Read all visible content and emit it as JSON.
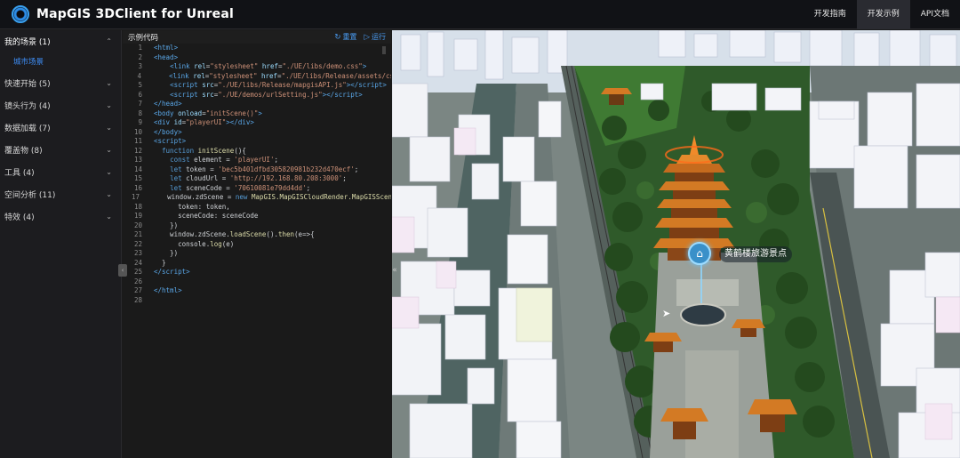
{
  "app": {
    "title": "MapGIS 3DClient for Unreal"
  },
  "nav": {
    "items": [
      {
        "label": "开发指南",
        "active": false
      },
      {
        "label": "开发示例",
        "active": true
      },
      {
        "label": "API文档",
        "active": false
      }
    ]
  },
  "sidebar": {
    "groups": [
      {
        "label": "我的场景 (1)",
        "open": true
      },
      {
        "label": "快速开始 (5)"
      },
      {
        "label": "镜头行为 (4)"
      },
      {
        "label": "数据加载 (7)"
      },
      {
        "label": "覆盖物 (8)"
      },
      {
        "label": "工具 (4)"
      },
      {
        "label": "空间分析 (11)"
      },
      {
        "label": "特效 (4)"
      }
    ],
    "sub_item": "城市场景"
  },
  "code_panel": {
    "title": "示例代码",
    "reset_label": "重置",
    "run_label": "运行"
  },
  "scene": {
    "poi_label": "黄鹤楼旅游景点"
  },
  "colors": {
    "accent": "#3e8ef7",
    "topbar": "#111216",
    "sidebar": "#1c1c1f",
    "code_bg": "#1a1a1a"
  },
  "icons": {
    "reset": "refresh-icon",
    "run": "play-circle-icon",
    "logo": "mapgis-logo-icon",
    "poi": "home-marker-icon"
  }
}
